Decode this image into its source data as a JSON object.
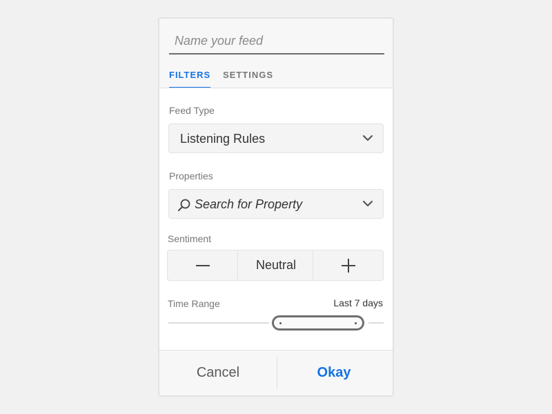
{
  "feed_name": {
    "value": "",
    "placeholder": "Name your feed"
  },
  "tabs": [
    {
      "label": "FILTERS",
      "active": true
    },
    {
      "label": "SETTINGS",
      "active": false
    }
  ],
  "feed_type": {
    "label": "Feed Type",
    "selected": "Listening Rules"
  },
  "properties": {
    "label": "Properties",
    "placeholder": "Search for Property"
  },
  "sentiment": {
    "label": "Sentiment",
    "value": "Neutral"
  },
  "time_range": {
    "label": "Time Range",
    "value": "Last 7 days"
  },
  "footer": {
    "cancel_label": "Cancel",
    "okay_label": "Okay"
  },
  "colors": {
    "accent": "#1473e6",
    "text": "#333333",
    "muted": "#777777"
  },
  "icons": {
    "chevron": "chevron-down-icon",
    "search": "search-icon",
    "minus": "minus-icon",
    "plus": "plus-icon"
  }
}
